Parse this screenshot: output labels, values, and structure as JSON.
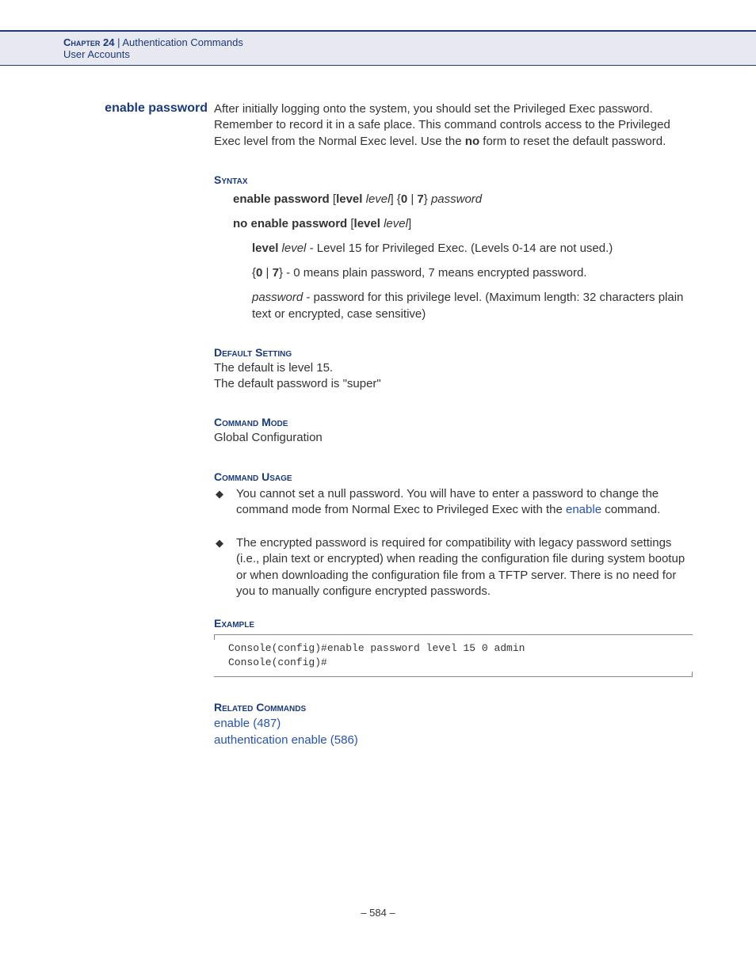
{
  "header": {
    "chapter": "Chapter 24",
    "separator": "  |  ",
    "section": "Authentication Commands",
    "subsection": "User Accounts"
  },
  "command": {
    "title": "enable password",
    "intro_1": "After initially logging onto the system, you should set the Privileged Exec password. Remember to record it in a safe place. This command controls access to the Privileged Exec level from the Normal Exec level. Use the ",
    "intro_no": "no",
    "intro_2": " form to reset the default password."
  },
  "syntax": {
    "label": "Syntax",
    "l1_cmd": "enable password",
    "l1_bracket_open": " [",
    "l1_level": "level",
    "l1_space": " ",
    "l1_level_it": "level",
    "l1_bracket_close": "] {",
    "l1_zero": "0",
    "l1_pipe": " | ",
    "l1_seven": "7",
    "l1_close_brace": "} ",
    "l1_password": "password",
    "l2_cmd": "no enable password",
    "l2_bracket_open": " [",
    "l2_level": "level",
    "l2_space": " ",
    "l2_level_it": "level",
    "l2_bracket_close": "]",
    "p1_level_b": "level",
    "p1_level_it": " level",
    "p1_text": " - Level 15 for Privileged Exec. (Levels 0-14 are not used.)",
    "p2_open": "{",
    "p2_zero": "0",
    "p2_pipe": " | ",
    "p2_seven": "7",
    "p2_close": "}",
    "p2_text": " - 0 means plain password, 7 means encrypted password.",
    "p3_password": "password",
    "p3_text": " - password for this privilege level. (Maximum length: 32 characters plain text or encrypted, case sensitive)"
  },
  "default": {
    "label": "Default Setting",
    "line1": "The default is level 15.",
    "line2": "The default password is \"super\""
  },
  "mode": {
    "label": "Command Mode",
    "text": "Global Configuration"
  },
  "usage": {
    "label": "Command Usage",
    "b1_a": "You cannot set a null password. You will have to enter a password to change the command mode from Normal Exec to Privileged Exec with the ",
    "b1_link": "enable",
    "b1_b": " command.",
    "b2": "The encrypted password is required for compatibility with legacy password settings (i.e., plain text or encrypted) when reading the configuration file during system bootup or when downloading the configuration file from a TFTP server. There is no need for you to manually configure encrypted passwords."
  },
  "example": {
    "label": "Example",
    "line1": "Console(config)#enable password level 15 0 admin",
    "line2": "Console(config)#"
  },
  "related": {
    "label": "Related Commands",
    "link1": "enable (487)",
    "link2": "authentication enable (586)"
  },
  "page": "–  584  –"
}
